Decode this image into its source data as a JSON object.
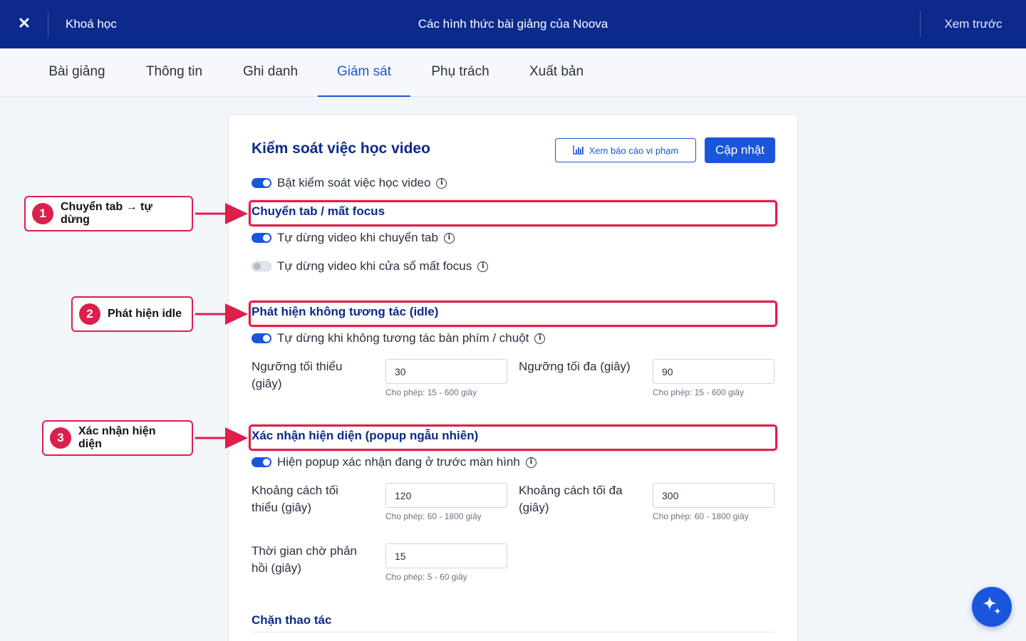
{
  "header": {
    "course_link": "Khoá học",
    "title": "Các hình thức bài giảng của Noova",
    "preview": "Xem trước"
  },
  "tabs": [
    {
      "label": "Bài giảng"
    },
    {
      "label": "Thông tin"
    },
    {
      "label": "Ghi danh"
    },
    {
      "label": "Giám sát",
      "active": true
    },
    {
      "label": "Phụ trách"
    },
    {
      "label": "Xuất bản"
    }
  ],
  "card": {
    "title": "Kiểm soát việc học video",
    "report_button": "Xem báo cáo vi phạm",
    "update_button": "Cập nhật",
    "master_toggle": {
      "label": "Bật kiểm soát việc học video",
      "on": true
    },
    "tab_focus": {
      "title": "Chuyển tab / mất focus",
      "toggles": [
        {
          "label": "Tự dừng video khi chuyển tab",
          "on": true
        },
        {
          "label": "Tự dừng video khi cửa sổ mất focus",
          "on": false
        }
      ]
    },
    "idle": {
      "title": "Phát hiện không tương tác (idle)",
      "toggle": {
        "label": "Tự dừng khi không tương tác bàn phím / chuột",
        "on": true
      },
      "min_label": "Ngưỡng tối thiểu (giây)",
      "min_value": "30",
      "min_hint": "Cho phép: 15 - 600 giây",
      "max_label": "Ngưỡng tối đa (giây)",
      "max_value": "90",
      "max_hint": "Cho phép: 15 - 600 giây"
    },
    "presence": {
      "title": "Xác nhận hiện diện (popup ngẫu nhiên)",
      "toggle": {
        "label": "Hiện popup xác nhận đang ở trước màn hình",
        "on": true
      },
      "min_label": "Khoảng cách tối thiểu (giây)",
      "min_value": "120",
      "min_hint": "Cho phép: 60 - 1800 giây",
      "max_label": "Khoảng cách tối đa (giây)",
      "max_value": "300",
      "max_hint": "Cho phép: 60 - 1800 giây",
      "wait_label": "Thời gian chờ phản hồi (giây)",
      "wait_value": "15",
      "wait_hint": "Cho phép: 5 - 60 giây"
    },
    "block": {
      "title": "Chặn thao tác"
    }
  },
  "annotations": [
    {
      "number": "1",
      "label": "Chuyển tab → tự dừng"
    },
    {
      "number": "2",
      "label": "Phát hiện idle"
    },
    {
      "number": "3",
      "label": "Xác nhận hiện diện"
    }
  ],
  "colors": {
    "header_bg": "#0c2a8c",
    "accent": "#1a56db",
    "annotation_red": "#dc1f4b"
  },
  "icons": [
    "close-icon",
    "bar-chart-icon",
    "info-icon",
    "sparkle-icon"
  ]
}
